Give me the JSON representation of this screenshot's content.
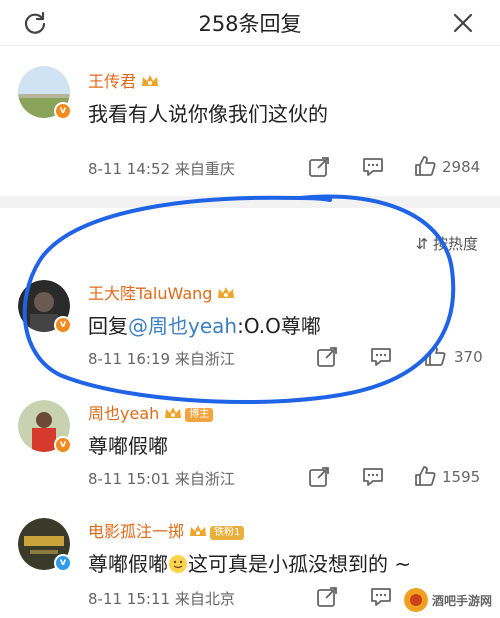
{
  "header": {
    "title": "258条回复",
    "refresh_icon": "refresh-icon",
    "close_icon": "close-icon"
  },
  "sort": {
    "label": "按热度"
  },
  "comments": [
    {
      "name": "王传君",
      "text": "我看有人说你像我们这伙的",
      "date": "8-11 14:52",
      "source": "来自重庆",
      "likes": "2984",
      "badge": "crown"
    },
    {
      "name": "王大陸TaluWang",
      "reply_prefix": "回复",
      "mention": "@周也yeah",
      "text_suffix": ":O.O尊嘟",
      "date": "8-11 16:19",
      "source": "来自浙江",
      "likes": "370",
      "badge": "crown"
    },
    {
      "name": "周也yeah",
      "tag": "博主",
      "text": "尊嘟假嘟",
      "date": "8-11 15:01",
      "source": "来自浙江",
      "likes": "1595"
    },
    {
      "name": "电影孤注一掷",
      "tag": "铁粉1",
      "text_before": "尊嘟假嘟",
      "text_after": "这可真是小孤没想到的 ~",
      "date": "8-11 15:11",
      "source": "来自北京"
    }
  ],
  "watermark": "酒吧手游网",
  "colors": {
    "name": "#e06a18",
    "mention": "#3d7fc4",
    "circle": "#1f63e6",
    "verified_orange": "#f38a1b",
    "verified_blue": "#2f9bf0"
  }
}
